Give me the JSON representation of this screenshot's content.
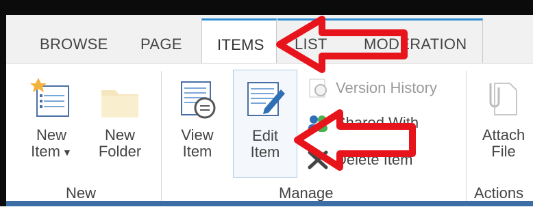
{
  "tabs": [
    {
      "label": "BROWSE"
    },
    {
      "label": "PAGE"
    },
    {
      "label": "ITEMS"
    },
    {
      "label": "LIST"
    },
    {
      "label": "MODERATION"
    }
  ],
  "groups": {
    "new": {
      "label": "New",
      "new_item": {
        "line1": "New",
        "line2": "Item"
      },
      "new_folder": {
        "line1": "New",
        "line2": "Folder"
      }
    },
    "manage": {
      "label": "Manage",
      "view_item": {
        "line1": "View",
        "line2": "Item"
      },
      "edit_item": {
        "line1": "Edit",
        "line2": "Item"
      },
      "version_history": "Version History",
      "shared_with": "Shared With",
      "delete_item": "Delete Item"
    },
    "actions": {
      "label": "Actions",
      "attach_file": {
        "line1": "Attach",
        "line2": "File"
      }
    }
  },
  "colors": {
    "accent": "#2a8dd4",
    "arrow": "#e8141c"
  }
}
